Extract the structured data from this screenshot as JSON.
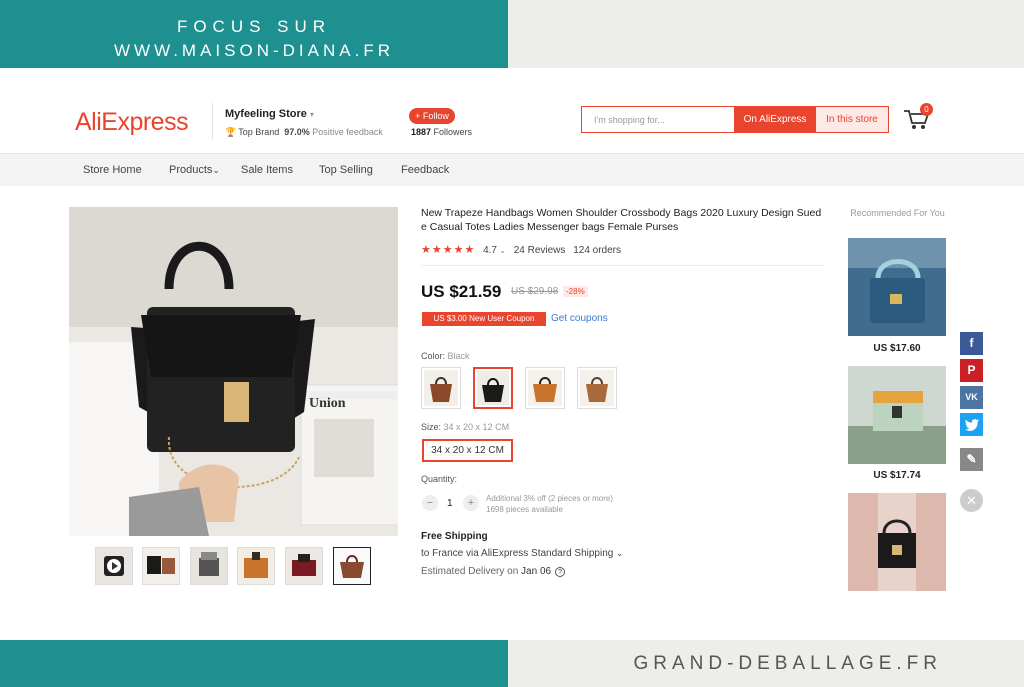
{
  "banner_top": {
    "line1": "FOCUS SUR",
    "line2": "WWW.MAISON-DIANA.FR"
  },
  "banner_bottom": {
    "text": "GRAND-DEBALLAGE.FR"
  },
  "header": {
    "logo": "AliExpress",
    "store_name": "Myfeeling Store",
    "top_brand": "Top Brand",
    "feedback_percent": "97.0%",
    "feedback_label": "Positive feedback",
    "follow_label": "+ Follow",
    "followers_count": "1887",
    "followers_label": "Followers",
    "search_placeholder": "I'm shopping for...",
    "search_aliexpress": "On AliExpress",
    "search_store": "In this store",
    "cart_count": "0"
  },
  "nav": [
    "Store Home",
    "Products",
    "Sale Items",
    "Top Selling",
    "Feedback"
  ],
  "product": {
    "title": "New Trapeze Handbags Women Shoulder Crossbody Bags 2020 Luxury Design Sued e Casual Totes Ladies Messenger bags Female Purses",
    "rating": "4.7",
    "reviews": "24 Reviews",
    "orders": "124 orders",
    "price": "US $21.59",
    "old_price": "US $29.98",
    "discount": "-28%",
    "coupon": "US $3.00 New User Coupon",
    "get_coupons": "Get coupons",
    "color_label": "Color:",
    "color_value": "Black",
    "size_label": "Size:",
    "size_value": "34 x 20 x 12 CM",
    "size_option": "34 x 20 x 12 CM",
    "quantity_label": "Quantity:",
    "quantity": "1",
    "qty_note1": "Additional 3% off (2 pieces or more)",
    "qty_note2": "1698 pieces available",
    "shipping_title": "Free Shipping",
    "shipping_detail": "to France via AliExpress Standard Shipping",
    "delivery_label": "Estimated Delivery on",
    "delivery_date": "Jan 06"
  },
  "recommended": {
    "title": "Recommended For You",
    "prices": [
      "US $17.60",
      "US $17.74"
    ]
  },
  "colors": {
    "accent": "#e8442e",
    "teal": "#1e9090",
    "facebook": "#3b5998",
    "pinterest": "#cb2027",
    "vk": "#4c75a3",
    "twitter": "#1da1f2"
  }
}
